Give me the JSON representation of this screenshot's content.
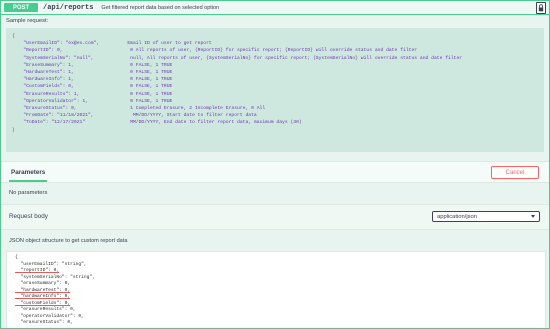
{
  "operation": {
    "method": "POST",
    "path": "/api/reports",
    "summary": "Get filtered report data based on selected option",
    "lock_icon": "lock-icon"
  },
  "sample": {
    "label": "Sample request:",
    "lines": [
      "{",
      "    \"UserEmailID\": \"ex@ex.com\",          Email ID of user to get report",
      "    \"ReportID\": 0,                        0 All reports of user, {ReportID} for specific report; {ReportID} will override status and date filter",
      "    \"SystemSerialNo\": \"null\",             null, All reports of user, {SystemSerialNo} for specific report; {SystemSerialNo} will override status and date filter",
      "    \"EraseSummary\": 1,                    0 FALSE, 1 TRUE",
      "    \"HardwareTest\": 1,                    0 FALSE, 1 TRUE",
      "    \"HardwareInfo\": 1,                    0 FALSE, 1 TRUE",
      "    \"CustomFields\": 0,                    0 FALSE, 1 TRUE",
      "    \"ErasureResults\": 1,                  0 FALSE, 1 TRUE",
      "    \"OperatorValidator\": 1,               0 FALSE, 1 TRUE",
      "    \"ErasureStatus\": 0,                   1 Completed Erasure, 2 Incomplete Erasure, 0 All",
      "    \"FromDate\": \"11/18/2021\",              MM/DD/YYYY, Start date to filter report data",
      "    \"ToDate\": \"12/17/2021\"                MM/DD/YYYY, End date to filter report data, maximum days (30)",
      "}"
    ]
  },
  "parameters": {
    "tab_label": "Parameters",
    "cancel_label": "Cancel",
    "empty_text": "No parameters"
  },
  "request_body": {
    "label": "Request body",
    "content_type": "application/json"
  },
  "json_structure": {
    "label": "JSON object structure to get custom report data",
    "lines": [
      "{",
      "  \"userEmailID\": \"string\",",
      "  \"reportID\": 0,",
      "  \"systemSerialNo\": \"string\",",
      "  \"eraseSummary\": 0,",
      "  \"hardwareTest\": 0,",
      "  \"hardwareInfo\": 0,",
      "  \"customFields\": 0,",
      "  \"erasureResults\": 0,",
      "  \"operatorValidator\": 0,",
      "  \"erasureStatus\": 0,"
    ]
  }
}
